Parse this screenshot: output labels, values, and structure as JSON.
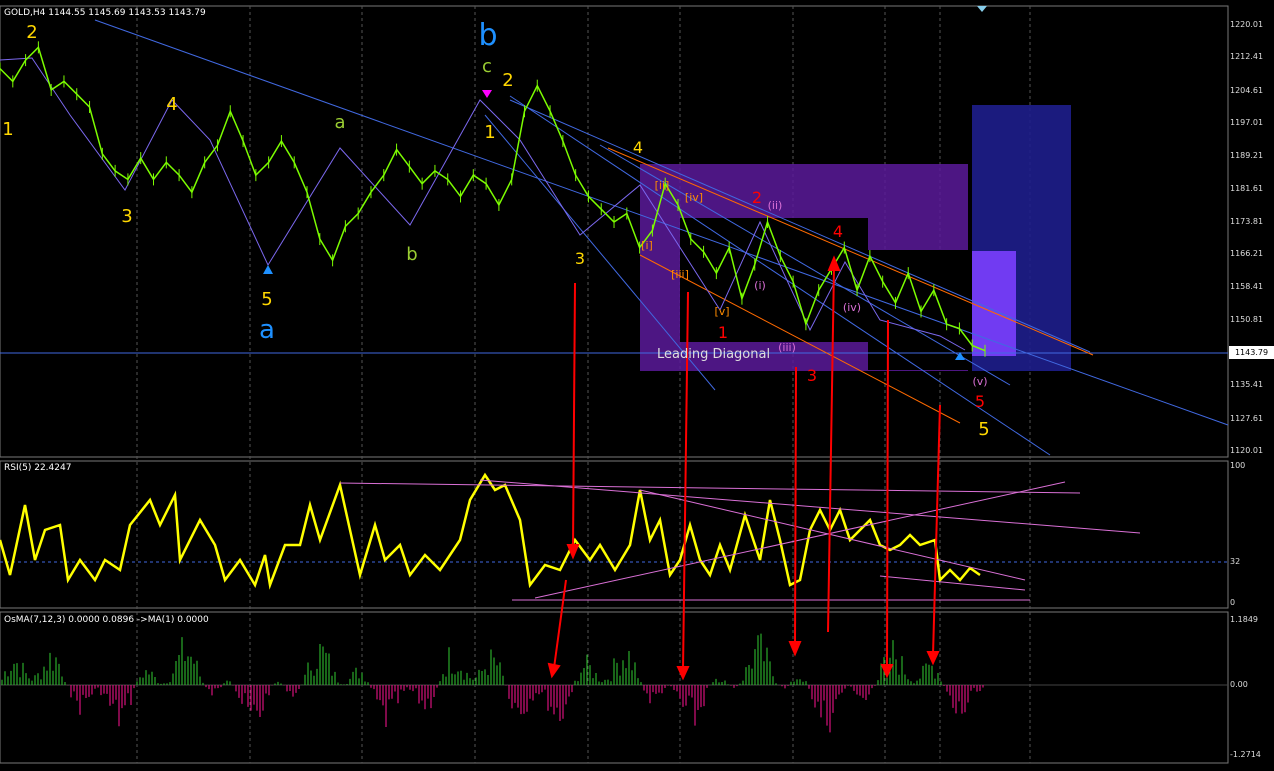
{
  "main_panel": {
    "header": "GOLD,H4  1144.55 1145.69 1143.53 1143.79",
    "current_price": "1143.79",
    "price_scale": [
      "1220.01",
      "1212.41",
      "1204.61",
      "1197.01",
      "1189.21",
      "1181.61",
      "1173.81",
      "1166.21",
      "1158.41",
      "1150.81",
      "1143.79",
      "1135.41",
      "1127.61",
      "1120.01"
    ]
  },
  "rsi_panel": {
    "header": "RSI(5) 22.4247",
    "scale": [
      "100",
      "32",
      "0"
    ]
  },
  "osma_panel": {
    "header": "OsMA(7,12,3) 0.0000 0.0896  ->MA(1) 0.0000",
    "scale": [
      "1.1849",
      "0.00",
      "-1.2714"
    ]
  },
  "colors": {
    "price_line": "#7CFC00",
    "rsi_line": "#ffff00",
    "trend_line": "#4169e1",
    "wave_label_yellow": "#ffd700",
    "wave_label_red": "#ff0000",
    "wave_label_magenta": "#da70d6",
    "wave_label_cyan": "#1e90ff",
    "arrow": "#ff0000",
    "box_purple": "#5a1a9a",
    "box_blue": "#1e1e8c"
  },
  "chart_data": {
    "type": "line",
    "series": [
      {
        "values": [
          1210,
          1207,
          1212,
          1215,
          1205,
          1207,
          1204,
          1201,
          1190,
          1186,
          1184,
          1189,
          1184,
          1188,
          1185,
          1181,
          1188,
          1192,
          1200,
          1193,
          1185,
          1188,
          1193,
          1188,
          1181,
          1170,
          1165,
          1173,
          1176,
          1181,
          1185,
          1191,
          1187,
          1183,
          1186,
          1184,
          1180,
          1185,
          1183,
          1178,
          1184,
          1200,
          1206,
          1200,
          1193,
          1185,
          1180,
          1177,
          1174,
          1176,
          1168,
          1172,
          1183,
          1178,
          1170,
          1167,
          1162,
          1168,
          1156,
          1164,
          1174,
          1166,
          1160,
          1150,
          1158,
          1163,
          1168,
          1158,
          1166,
          1160,
          1155,
          1162,
          1153,
          1158,
          1150,
          1149,
          1145,
          1143.79
        ]
      }
    ]
  },
  "wave_labels": [
    {
      "t": "2",
      "c": "yellow"
    },
    {
      "t": "1",
      "c": "yellow"
    },
    {
      "t": "3",
      "c": "yellow"
    },
    {
      "t": "4",
      "c": "yellow"
    },
    {
      "t": "5",
      "c": "yellow"
    },
    {
      "t": "a",
      "c": "cyan"
    },
    {
      "t": "a",
      "c": "olive"
    },
    {
      "t": "b",
      "c": "olive"
    },
    {
      "t": "b",
      "c": "cyan"
    },
    {
      "t": "c",
      "c": "olive"
    },
    {
      "t": "2",
      "c": "yellow"
    },
    {
      "t": "1",
      "c": "yellow"
    },
    {
      "t": "4",
      "c": "yellow"
    },
    {
      "t": "3",
      "c": "yellow"
    },
    {
      "t": "[i]",
      "c": "orange"
    },
    {
      "t": "[ii]",
      "c": "orange"
    },
    {
      "t": "[iii]",
      "c": "orange"
    },
    {
      "t": "[iv]",
      "c": "orange"
    },
    {
      "t": "[v]",
      "c": "orange"
    },
    {
      "t": "1",
      "c": "red"
    },
    {
      "t": "2",
      "c": "red"
    },
    {
      "t": "3",
      "c": "red"
    },
    {
      "t": "4",
      "c": "red"
    },
    {
      "t": "5",
      "c": "red"
    },
    {
      "t": "(i)",
      "c": "magenta"
    },
    {
      "t": "(ii)",
      "c": "magenta"
    },
    {
      "t": "(iii)",
      "c": "magenta"
    },
    {
      "t": "(iv)",
      "c": "magenta"
    },
    {
      "t": "(v)",
      "c": "magenta"
    },
    {
      "t": "5",
      "c": "yellow"
    }
  ],
  "annotation": "Leading Diagonal"
}
